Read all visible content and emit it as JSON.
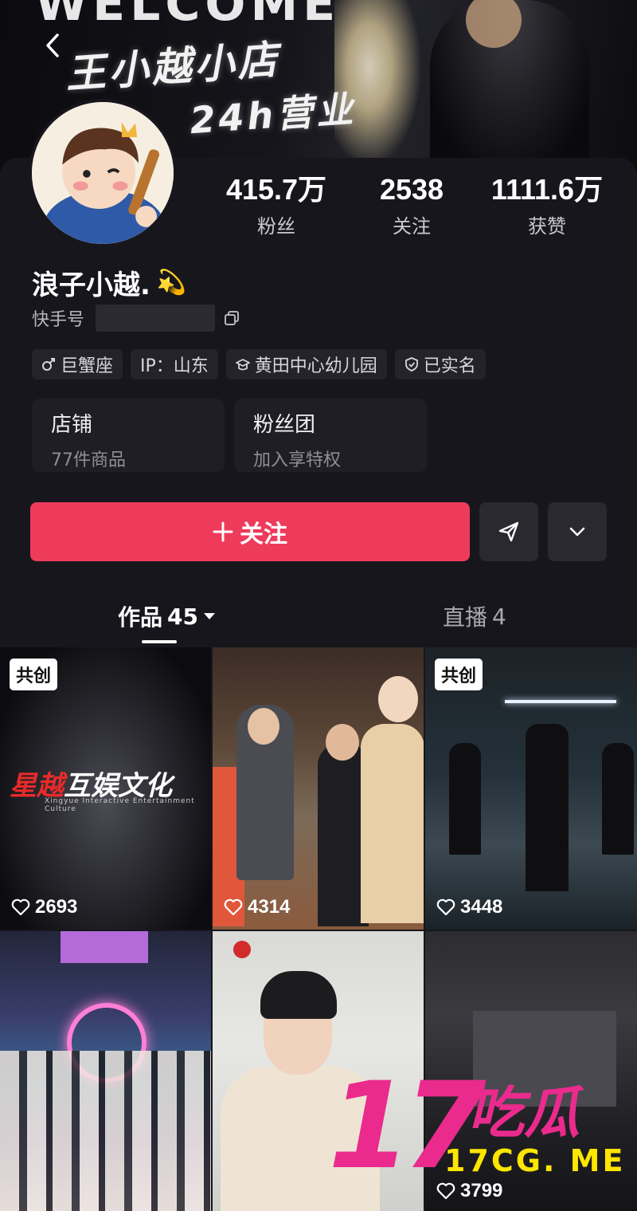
{
  "banner": {
    "welcome_text": "WELCOME",
    "slogan_line1": "王小越小店",
    "slogan_line2": "24h营业"
  },
  "profile": {
    "nickname": "浪子小越.",
    "nickname_emoji": "💫",
    "kuaishou_id_label": "快手号",
    "stats": [
      {
        "value": "415.7万",
        "label": "粉丝"
      },
      {
        "value": "2538",
        "label": "关注"
      },
      {
        "value": "1111.6万",
        "label": "获赞"
      }
    ],
    "tags": [
      {
        "icon": "male-icon",
        "text": "巨蟹座"
      },
      {
        "icon": "",
        "text": "IP：山东"
      },
      {
        "icon": "school-icon",
        "text": "黄田中心幼儿园"
      },
      {
        "icon": "verified-shield-icon",
        "text": "已实名"
      }
    ],
    "features": [
      {
        "title": "店铺",
        "subtitle": "77件商品"
      },
      {
        "title": "粉丝团",
        "subtitle": "加入享特权"
      }
    ]
  },
  "actions": {
    "follow_label": "关注",
    "follow_icon": "plus-icon",
    "share_icon": "paper-plane-icon",
    "more_icon": "chevron-down-icon"
  },
  "tabs": {
    "works_label": "作品",
    "works_count": "45",
    "live_label": "直播",
    "live_count": "4"
  },
  "videos": [
    {
      "badge": "共创",
      "likes": "2693",
      "logo_red": "星越",
      "logo_white": "互娱文化",
      "logo_sub": "Xingyue Interactive Entertainment Culture"
    },
    {
      "badge": "",
      "likes": "4314"
    },
    {
      "badge": "共创",
      "likes": "3448"
    },
    {
      "badge": "",
      "likes": ""
    },
    {
      "badge": "",
      "likes": ""
    },
    {
      "badge": "",
      "likes": "3799"
    }
  ],
  "watermark": {
    "number": "17",
    "chinese": "吃瓜",
    "url": "17CG. ME"
  },
  "colors": {
    "background": "#17161c",
    "follow_button": "#ee3b5c",
    "watermark_pink": "#ea2b8d",
    "watermark_yellow": "#ffe600"
  }
}
